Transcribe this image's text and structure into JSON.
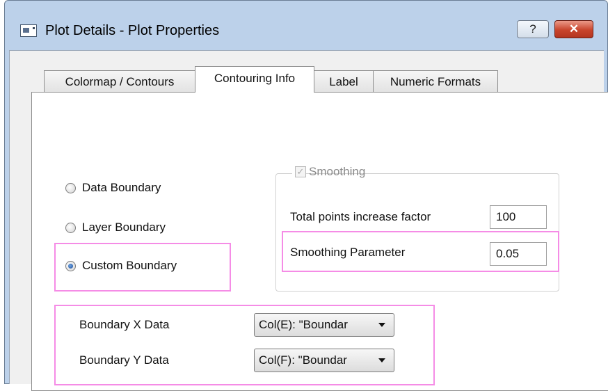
{
  "window": {
    "title": "Plot Details - Plot Properties",
    "help_label": "?",
    "close_label": "✕"
  },
  "tabs": [
    {
      "label": "Colormap / Contours"
    },
    {
      "label": "Contouring Info"
    },
    {
      "label": "Label"
    },
    {
      "label": "Numeric Formats"
    }
  ],
  "boundary_options": [
    {
      "label": "Data Boundary",
      "checked": false
    },
    {
      "label": "Layer Boundary",
      "checked": false
    },
    {
      "label": "Custom Boundary",
      "checked": true
    }
  ],
  "smoothing": {
    "label": "Smoothing",
    "checked": true,
    "enabled": false,
    "total_points_label": "Total points increase factor",
    "total_points_value": "100",
    "parameter_label": "Smoothing Parameter",
    "parameter_value": "0.05"
  },
  "boundary_data": {
    "x_label": "Boundary X Data",
    "x_value": "Col(E): \"Boundar",
    "y_label": "Boundary Y Data",
    "y_value": "Col(F): \"Boundar"
  },
  "highlight_color": "#f58ce6"
}
